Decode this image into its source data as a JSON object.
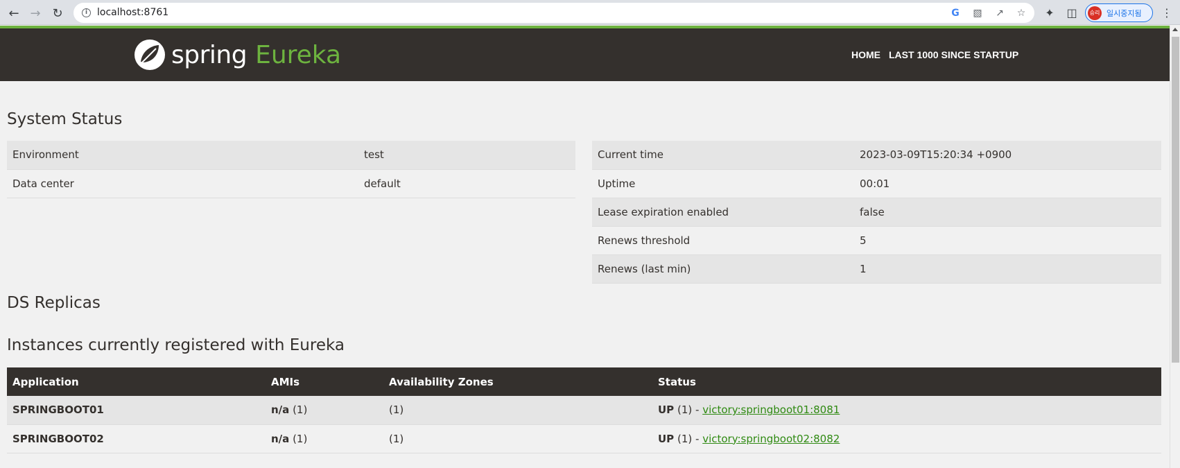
{
  "browser": {
    "url": "localhost:8761",
    "profile_label": "일시중지됨",
    "profile_initials": "승리"
  },
  "brand": {
    "spring": "spring",
    "eureka": "Eureka",
    "accent_color": "#6db33f",
    "nav_bg": "#34302d"
  },
  "nav": {
    "home": "HOME",
    "last1000": "LAST 1000 SINCE STARTUP"
  },
  "system_status": {
    "title": "System Status",
    "left": [
      {
        "key": "Environment",
        "value": "test"
      },
      {
        "key": "Data center",
        "value": "default"
      }
    ],
    "right": [
      {
        "key": "Current time",
        "value": "2023-03-09T15:20:34 +0900"
      },
      {
        "key": "Uptime",
        "value": "00:01"
      },
      {
        "key": "Lease expiration enabled",
        "value": "false"
      },
      {
        "key": "Renews threshold",
        "value": "5"
      },
      {
        "key": "Renews (last min)",
        "value": "1"
      }
    ]
  },
  "ds_replicas": {
    "title": "DS Replicas"
  },
  "instances": {
    "title": "Instances currently registered with Eureka",
    "headers": [
      "Application",
      "AMIs",
      "Availability Zones",
      "Status"
    ],
    "rows": [
      {
        "application": "SPRINGBOOT01",
        "ami_value": "n/a",
        "ami_count": "(1)",
        "zones": "(1)",
        "status": "UP",
        "status_count": "(1) -",
        "link": "victory:springboot01:8081"
      },
      {
        "application": "SPRINGBOOT02",
        "ami_value": "n/a",
        "ami_count": "(1)",
        "zones": "(1)",
        "status": "UP",
        "status_count": "(1) -",
        "link": "victory:springboot02:8082"
      }
    ]
  }
}
